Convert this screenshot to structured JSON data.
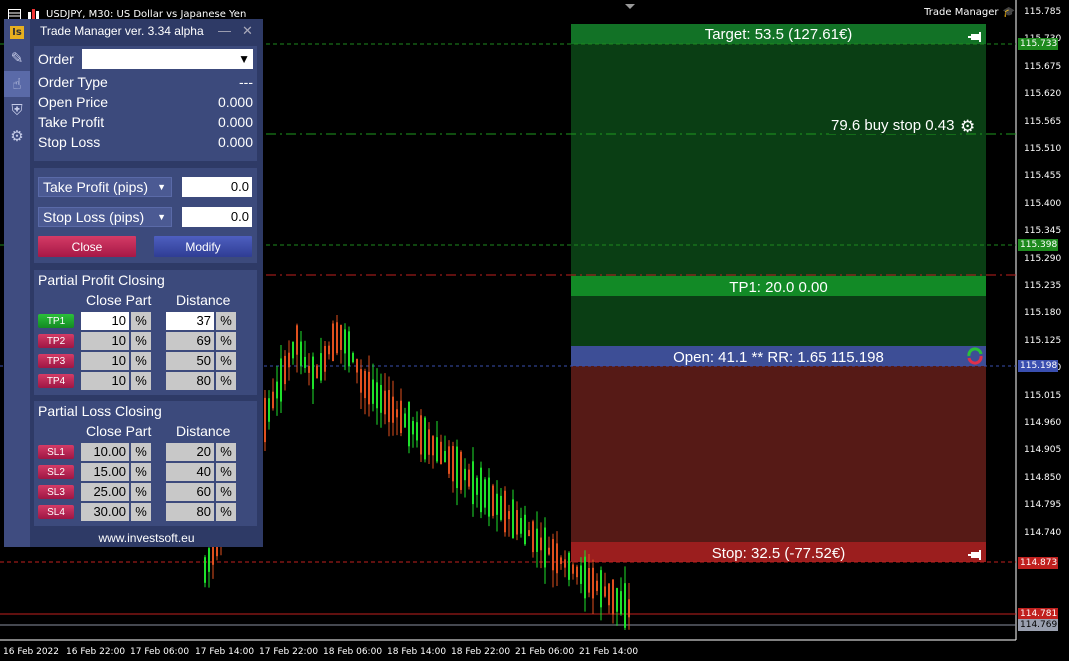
{
  "window": {
    "title": "USDJPY, M30:  US Dollar vs Japanese Yen",
    "indicator_label": "Trade Manager"
  },
  "panel": {
    "title": "Trade Manager ver. 3.34 alpha",
    "minimize": "—",
    "close": "✕",
    "order_label": "Order",
    "order_value": "",
    "info": [
      {
        "label": "Order Type",
        "value": "---"
      },
      {
        "label": "Open Price",
        "value": "0.000"
      },
      {
        "label": "Take Profit",
        "value": "0.000"
      },
      {
        "label": "Stop Loss",
        "value": "0.000"
      }
    ],
    "tp_mode": "Take Profit (pips)",
    "tp_value": "0.0",
    "sl_mode": "Stop Loss (pips)",
    "sl_value": "0.0",
    "close_button": "Close",
    "modify_button": "Modify",
    "partial_profit": {
      "title": "Partial Profit Closing",
      "col_part": "Close Part",
      "col_dist": "Distance",
      "rows": [
        {
          "tag": "TP1",
          "part": "10",
          "pct1": "%",
          "dist": "37",
          "pct2": "%"
        },
        {
          "tag": "TP2",
          "part": "10",
          "pct1": "%",
          "dist": "69",
          "pct2": "%"
        },
        {
          "tag": "TP3",
          "part": "10",
          "pct1": "%",
          "dist": "50",
          "pct2": "%"
        },
        {
          "tag": "TP4",
          "part": "10",
          "pct1": "%",
          "dist": "80",
          "pct2": "%"
        }
      ]
    },
    "partial_loss": {
      "title": "Partial Loss Closing",
      "col_part": "Close Part",
      "col_dist": "Distance",
      "rows": [
        {
          "tag": "SL1",
          "part": "10.00",
          "pct1": "%",
          "dist": "20",
          "pct2": "%"
        },
        {
          "tag": "SL2",
          "part": "15.00",
          "pct1": "%",
          "dist": "40",
          "pct2": "%"
        },
        {
          "tag": "SL3",
          "part": "25.00",
          "pct1": "%",
          "dist": "60",
          "pct2": "%"
        },
        {
          "tag": "SL4",
          "part": "30.00",
          "pct1": "%",
          "dist": "80",
          "pct2": "%"
        }
      ]
    },
    "footer": "www.investsoft.eu"
  },
  "overlay": {
    "target": "Target: 53.5 (127.61€)",
    "pending": "79.6 buy stop 0.43",
    "tp1": "TP1: 20.0 0.00",
    "open": "Open: 41.1 ** RR: 1.65 115.198",
    "stop": "Stop: 32.5 (-77.52€)"
  },
  "chart_data": {
    "type": "candlestick",
    "symbol": "USDJPY",
    "timeframe": "M30",
    "y_ticks": [
      "115.785",
      "115.730",
      "115.675",
      "115.620",
      "115.565",
      "115.510",
      "115.455",
      "115.400",
      "115.345",
      "115.290",
      "115.235",
      "115.180",
      "115.125",
      "115.070",
      "115.015",
      "114.960",
      "114.905",
      "114.850",
      "114.795",
      "114.740"
    ],
    "x_ticks": [
      "16 Feb 2022",
      "16 Feb 22:00",
      "17 Feb 06:00",
      "17 Feb 14:00",
      "17 Feb 22:00",
      "18 Feb 06:00",
      "18 Feb 14:00",
      "18 Feb 22:00",
      "21 Feb 06:00",
      "21 Feb 14:00"
    ],
    "price_labels": [
      {
        "value": "115.733",
        "color": "#1e8a1e"
      },
      {
        "value": "115.398",
        "color": "#1e8a1e"
      },
      {
        "value": "115.198",
        "color": "#3a4fb0"
      },
      {
        "value": "114.873",
        "color": "#c0201e"
      },
      {
        "value": "114.781",
        "color": "#c0201e"
      },
      {
        "value": "114.769",
        "color": "#9aa0b0"
      }
    ],
    "ylim": [
      114.74,
      115.8
    ],
    "colors": {
      "up": "#1ee12b",
      "down": "#e0501e"
    }
  }
}
